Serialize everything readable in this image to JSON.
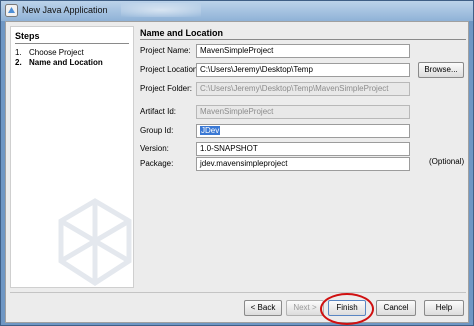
{
  "window": {
    "title": "New Java Application"
  },
  "steps": {
    "header": "Steps",
    "items": [
      {
        "number": "1.",
        "label": "Choose Project"
      },
      {
        "number": "2.",
        "label": "Name and Location"
      }
    ]
  },
  "main": {
    "header": "Name and Location",
    "fields": {
      "project_name": {
        "label": "Project Name:",
        "value": "MavenSimpleProject"
      },
      "project_location": {
        "label": "Project Location:",
        "value": "C:\\Users\\Jeremy\\Desktop\\Temp"
      },
      "project_folder": {
        "label": "Project Folder:",
        "value": "C:\\Users\\Jeremy\\Desktop\\Temp\\MavenSimpleProject"
      },
      "artifact_id": {
        "label": "Artifact Id:",
        "value": "MavenSimpleProject"
      },
      "group_id": {
        "label": "Group Id:",
        "value": "JDev"
      },
      "version": {
        "label": "Version:",
        "value": "1.0-SNAPSHOT"
      },
      "package": {
        "label": "Package:",
        "value": "jdev.mavensimpleproject",
        "note": "(Optional)"
      }
    },
    "browse_label": "Browse..."
  },
  "buttons": {
    "back": "< Back",
    "next": "Next >",
    "finish": "Finish",
    "cancel": "Cancel",
    "help": "Help"
  },
  "colors": {
    "highlight_ring": "#d01010",
    "selection": "#3a78d4"
  }
}
